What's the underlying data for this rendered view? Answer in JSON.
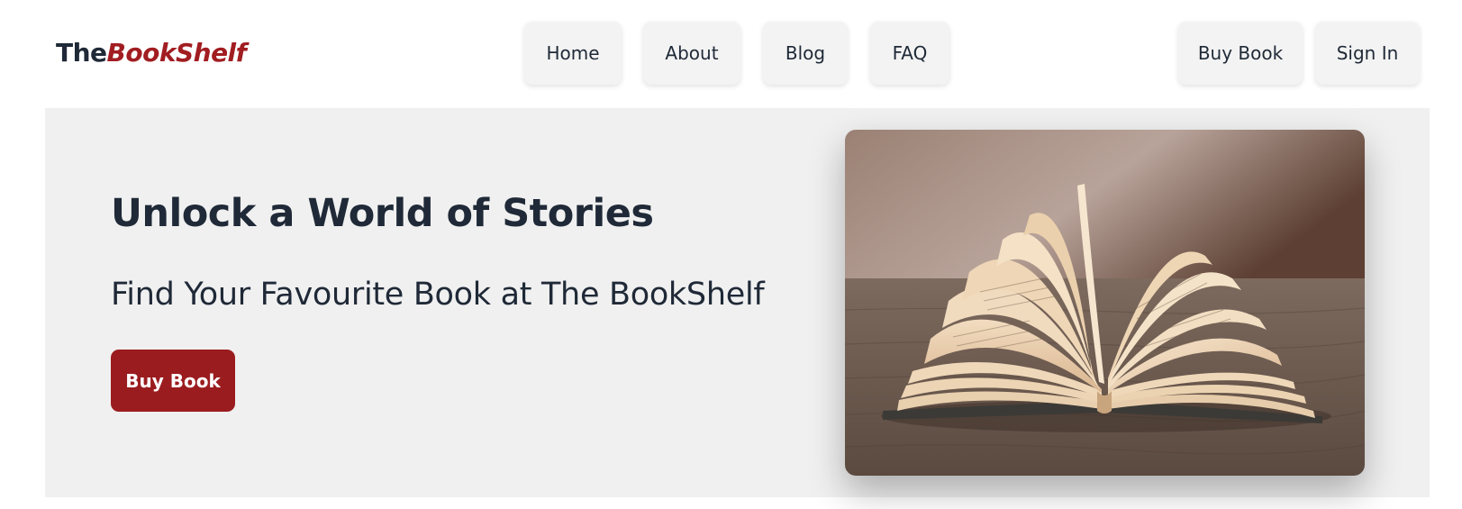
{
  "logo": {
    "part_1": "The",
    "part_2": "BookShelf"
  },
  "nav": {
    "items": [
      {
        "label": "Home"
      },
      {
        "label": "About"
      },
      {
        "label": "Blog"
      },
      {
        "label": "FAQ"
      }
    ],
    "actions": {
      "buy_book": "Buy Book",
      "sign_in": "Sign In"
    }
  },
  "hero": {
    "title": "Unlock a World of Stories",
    "subtitle": "Find Your Favourite Book at The BookShelf",
    "cta_label": "Buy Book",
    "image_icon": "open-book-photo"
  },
  "colors": {
    "brand": "#a11d21",
    "cta_background": "#9b1c1f",
    "hero_background": "#f0f0f0",
    "nav_button_background": "#f3f3f3",
    "text": "#1f2937"
  }
}
